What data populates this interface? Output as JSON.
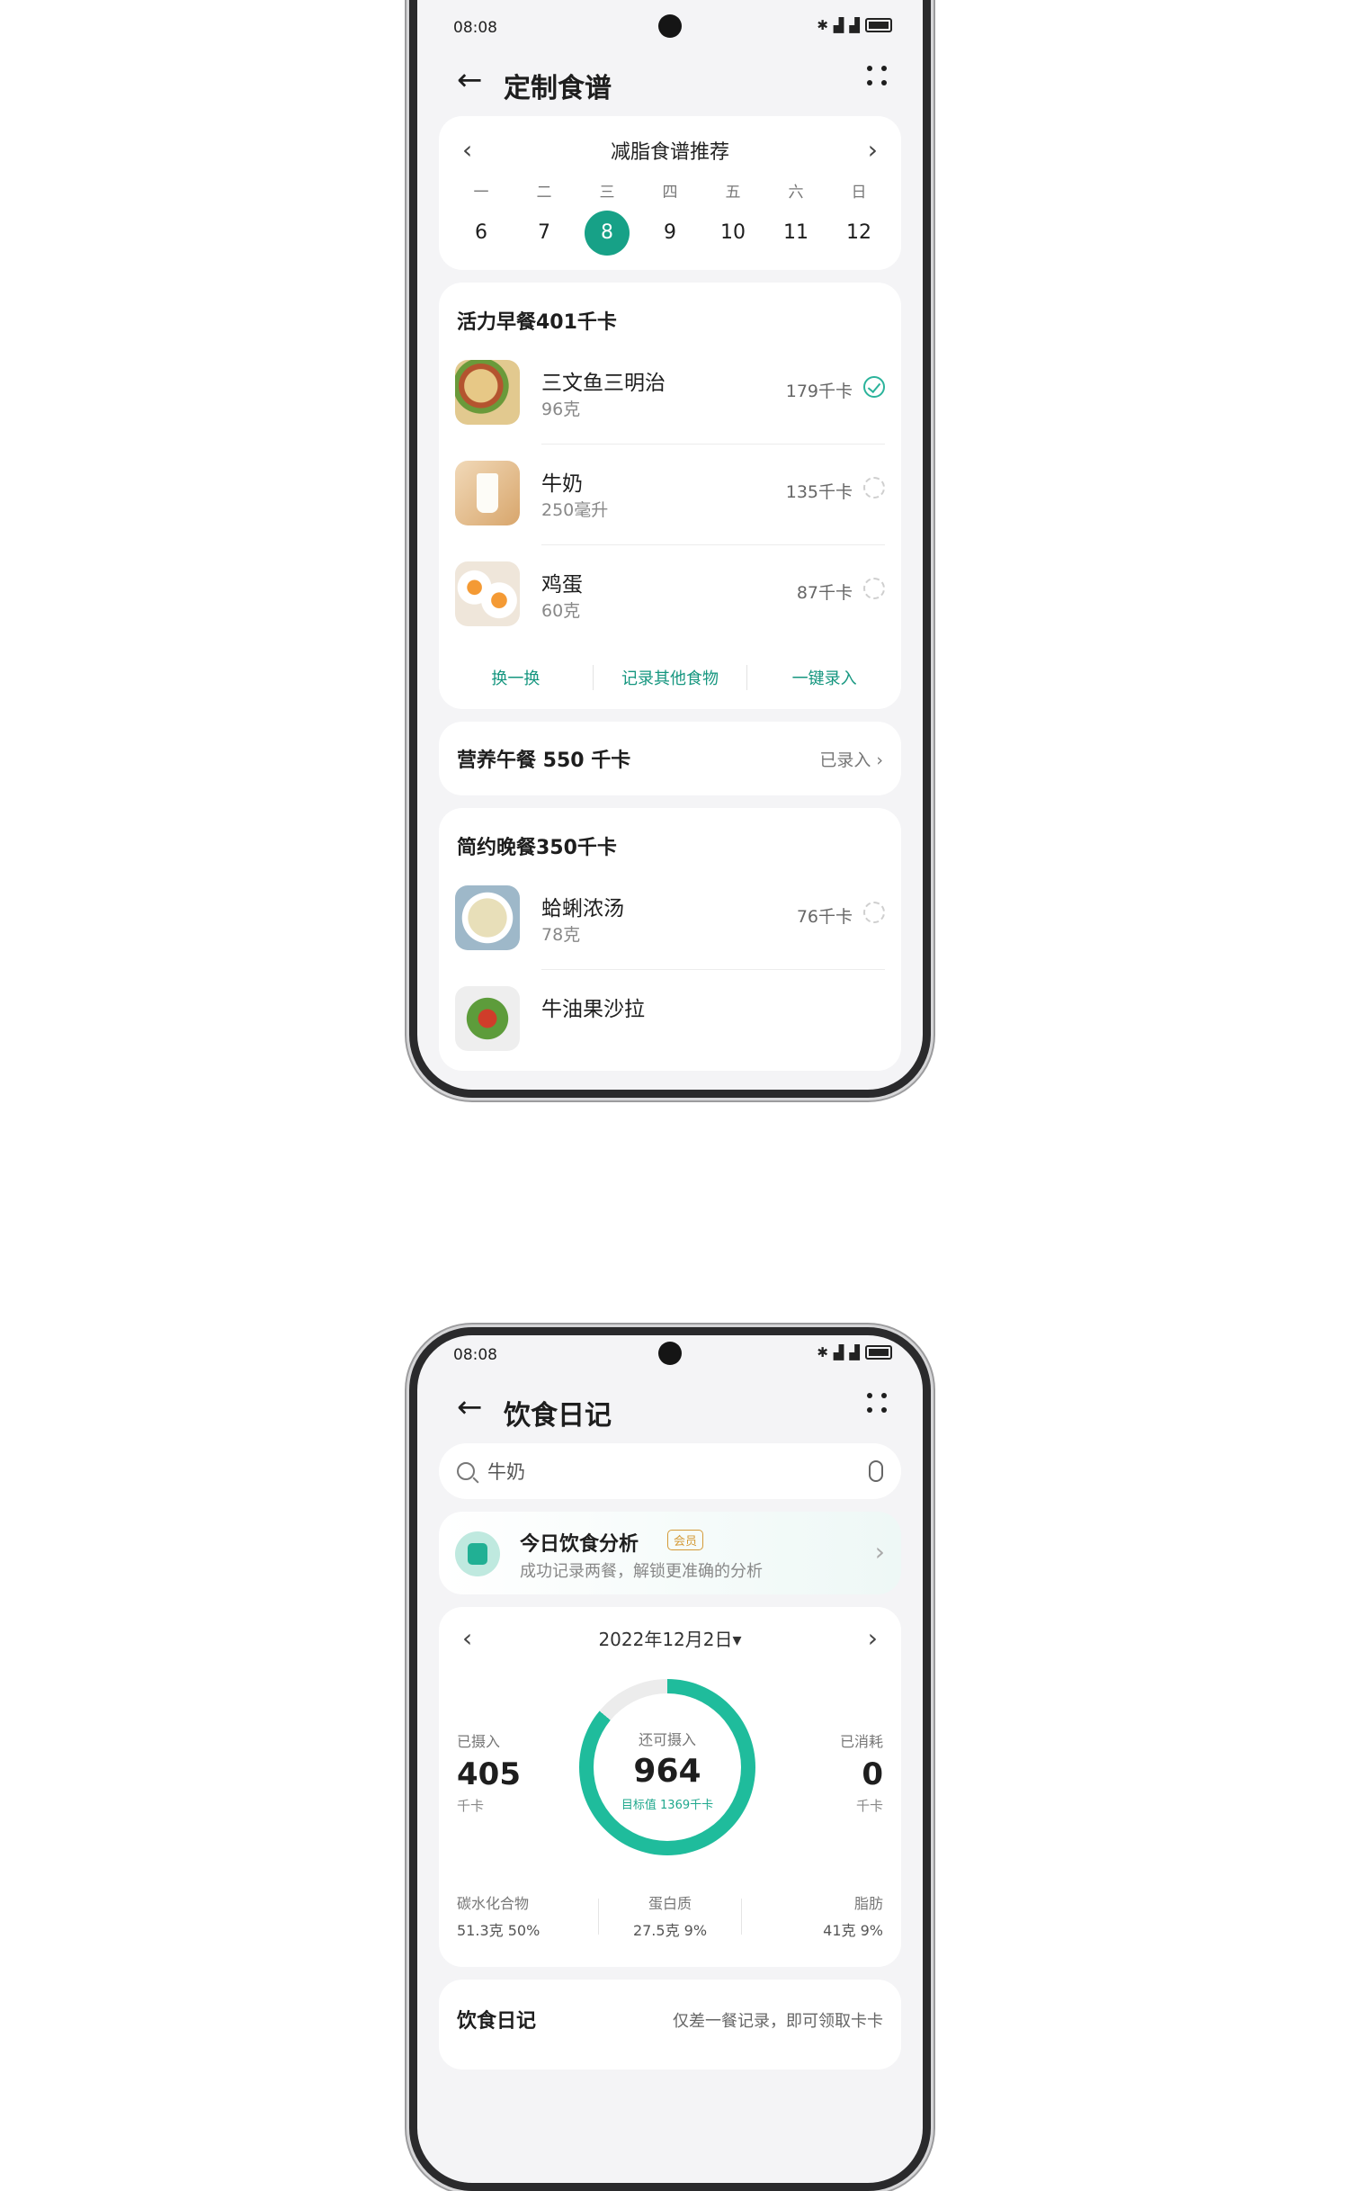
{
  "phone1": {
    "status_time": "08:08",
    "title": "定制食谱",
    "calendar": {
      "title": "减脂食谱推荐",
      "weekdays": [
        "一",
        "二",
        "三",
        "四",
        "五",
        "六",
        "日"
      ],
      "dates": [
        "6",
        "7",
        "8",
        "9",
        "10",
        "11",
        "12"
      ],
      "selected": "8"
    },
    "breakfast": {
      "title": "活力早餐401千卡",
      "items": [
        {
          "name": "三文鱼三明治",
          "amount": "96克",
          "kcal": "179千卡",
          "status": "done"
        },
        {
          "name": "牛奶",
          "amount": "250毫升",
          "kcal": "135千卡",
          "status": "pending"
        },
        {
          "name": "鸡蛋",
          "amount": "60克",
          "kcal": "87千卡",
          "status": "pending"
        }
      ],
      "actions": [
        "换一换",
        "记录其他食物",
        "一键录入"
      ]
    },
    "lunch": {
      "title": "营养午餐 550 千卡",
      "status": "已录入"
    },
    "dinner": {
      "title": "简约晚餐350千卡",
      "items": [
        {
          "name": "蛤蜊浓汤",
          "amount": "78克",
          "kcal": "76千卡",
          "status": "pending"
        },
        {
          "name": "牛油果沙拉",
          "amount": "",
          "kcal": "",
          "status": "pending"
        }
      ]
    }
  },
  "phone2": {
    "status_time": "08:08",
    "title": "饮食日记",
    "search_value": "牛奶",
    "analysis": {
      "title": "今日饮食分析",
      "badge": "会员",
      "subtitle": "成功记录两餐，解锁更准确的分析"
    },
    "summary": {
      "date": "2022年12月2日▾",
      "intake_label": "已摄入",
      "intake_value": "405",
      "intake_unit": "千卡",
      "remaining_label": "还可摄入",
      "remaining_value": "964",
      "target_text": "目标值 1369千卡",
      "burned_label": "已消耗",
      "burned_value": "0",
      "burned_unit": "千卡",
      "macros": [
        {
          "name": "碳水化合物",
          "value": "51.3克  50%"
        },
        {
          "name": "蛋白质",
          "value": "27.5克  9%"
        },
        {
          "name": "脂肪",
          "value": "41克  9%"
        }
      ]
    },
    "diary": {
      "title": "饮食日记",
      "note": "仅差一餐记录，即可领取卡卡"
    }
  },
  "colors": {
    "accent": "#17a187",
    "ring": "#1fbc9c"
  }
}
